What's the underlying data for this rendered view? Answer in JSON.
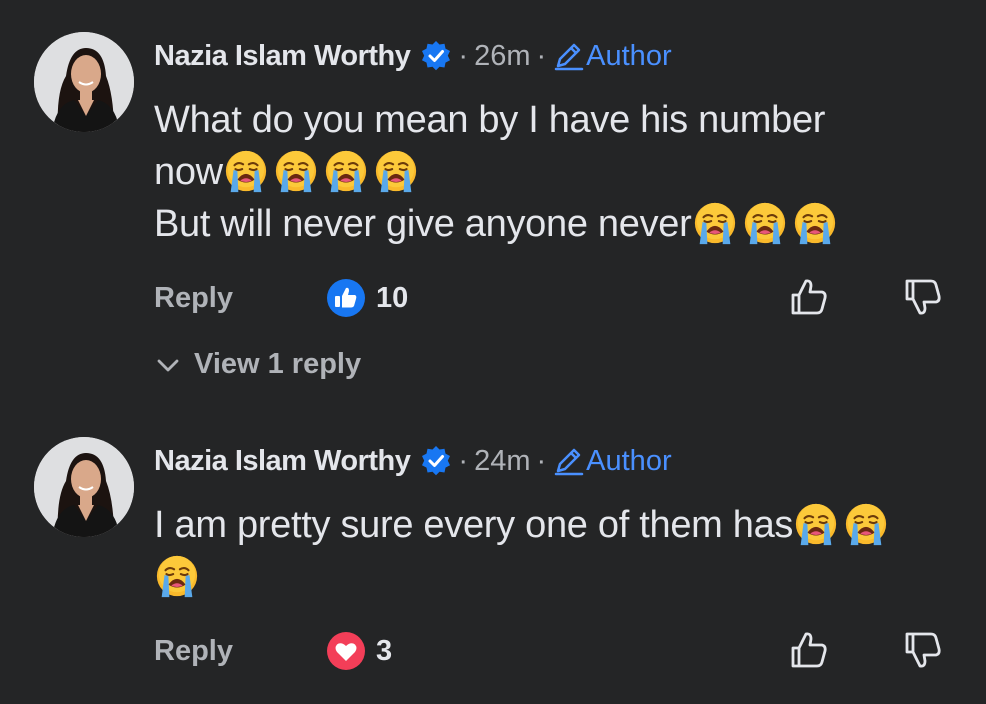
{
  "colors": {
    "background": "#242526",
    "primary_text": "#e4e6eb",
    "secondary_text": "#b0b3b8",
    "author_tag": "#4a90ff",
    "verified_badge": "#1877f2",
    "like_reaction": "#1877f2",
    "love_reaction": "#f33e58"
  },
  "comments": [
    {
      "author": "Nazia Islam Worthy",
      "verified": true,
      "separator": "·",
      "time": "26m",
      "tag": "Author",
      "lines": [
        "What do you mean by I have his number",
        "now",
        "But will never give anyone never"
      ],
      "emoji_name": "loudly-crying-face",
      "reply_label": "Reply",
      "reaction_icon": "like-icon",
      "reaction_count": "10"
    },
    {
      "author": "Nazia Islam Worthy",
      "verified": true,
      "separator": "·",
      "time": "24m",
      "tag": "Author",
      "lines": [
        "I am pretty sure every one of them has"
      ],
      "emoji_name": "loudly-crying-face",
      "reply_label": "Reply",
      "reaction_icon": "love-icon",
      "reaction_count": "3"
    }
  ],
  "view_replies": {
    "label": "View 1 reply",
    "icon": "chevron-down-icon"
  }
}
